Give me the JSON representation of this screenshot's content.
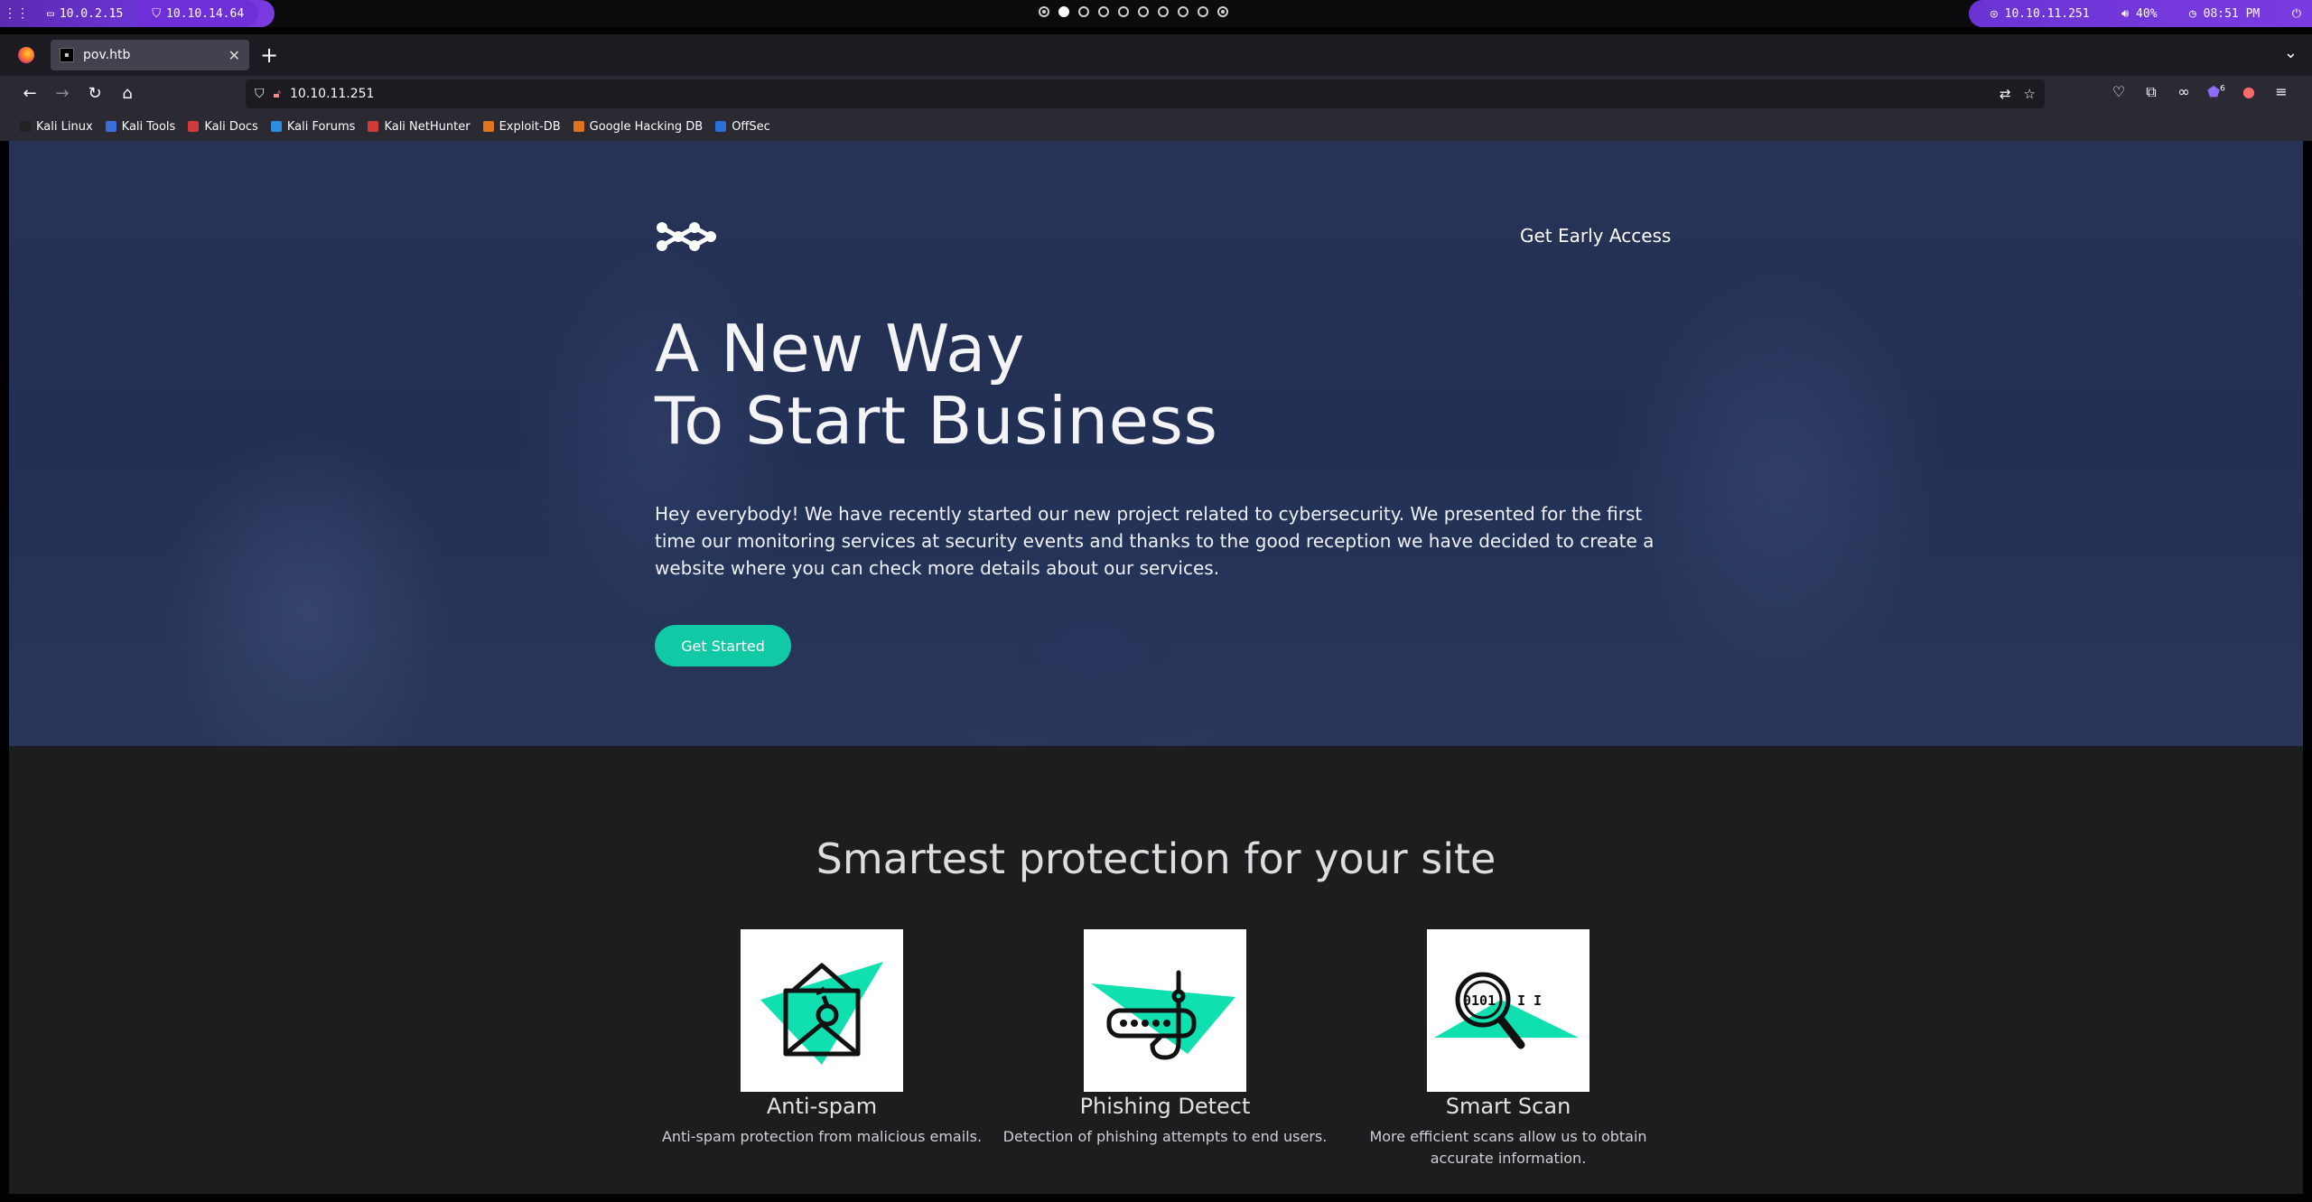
{
  "desktop_bar": {
    "vpn_ip": "10.0.2.15",
    "tun_ip": "10.10.14.64",
    "target_ip": "10.10.11.251",
    "volume": "40%",
    "time": "08:51 PM",
    "workspace_count": 10,
    "active_workspace": 2
  },
  "browser": {
    "tab_title": "pov.htb",
    "url": "10.10.11.251",
    "extension_badge": "6",
    "bookmarks": [
      {
        "label": "Kali Linux",
        "color": "#222222"
      },
      {
        "label": "Kali Tools",
        "color": "#3a6fd8"
      },
      {
        "label": "Kali Docs",
        "color": "#d03a3a"
      },
      {
        "label": "Kali Forums",
        "color": "#2a8fe0"
      },
      {
        "label": "Kali NetHunter",
        "color": "#d03a3a"
      },
      {
        "label": "Exploit-DB",
        "color": "#e0741c"
      },
      {
        "label": "Google Hacking DB",
        "color": "#e0741c"
      },
      {
        "label": "OffSec",
        "color": "#2a6fd8"
      }
    ]
  },
  "hero": {
    "nav_link": "Get Early Access",
    "heading_line1": "A New Way",
    "heading_line2": "To Start Business",
    "description": "Hey everybody! We have recently started our new project related to cybersecurity. We presented for the first time our monitoring services at security events and thanks to the good reception we have decided to create a website where you can check more details about our services.",
    "cta_label": "Get Started"
  },
  "features": {
    "heading": "Smartest protection for your site",
    "items": [
      {
        "title": "Anti-spam",
        "description": "Anti-spam protection from malicious emails.",
        "icon": "envelope-bomb-icon"
      },
      {
        "title": "Phishing Detect",
        "description": "Detection of phishing attempts to end users.",
        "icon": "phishing-hook-icon"
      },
      {
        "title": "Smart Scan",
        "description": "More efficient scans allow us to obtain accurate information.",
        "icon": "magnifier-binary-icon"
      }
    ]
  },
  "colors": {
    "accent": "#12c9a5",
    "hero_overlay": "#243257",
    "features_bg": "#1c1d1f",
    "desktop_purple": "#6b33d4"
  }
}
